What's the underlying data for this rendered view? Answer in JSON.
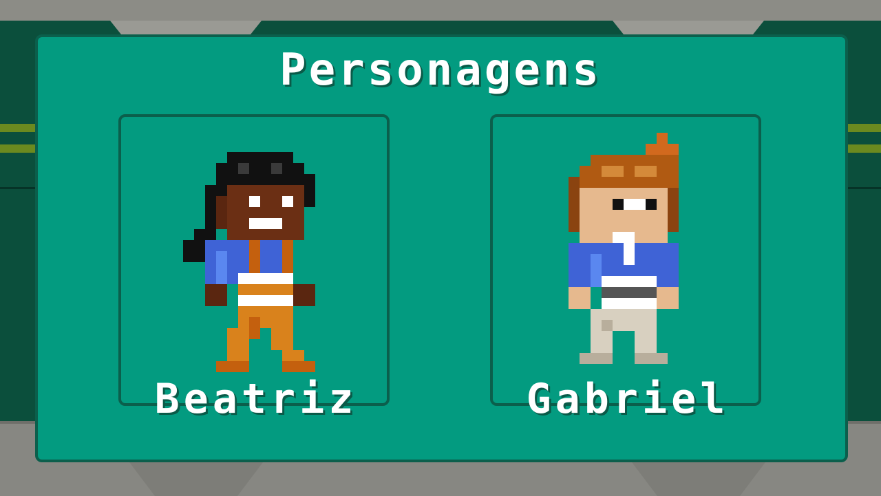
{
  "screen": {
    "title": "Personagens"
  },
  "characters": [
    {
      "name": "Beatriz",
      "sprite": "girl-with-braids",
      "colors": {
        "hair": "#111111",
        "skin": "#6b2f14",
        "shirt": "#3f63d6",
        "pants": "#d9821c"
      }
    },
    {
      "name": "Gabriel",
      "sprite": "boy-with-brown-hair",
      "colors": {
        "hair": "#b05a12",
        "skin": "#e6b98e",
        "shirt": "#3f63d6",
        "pants": "#d8d0c0"
      }
    }
  ],
  "colors": {
    "panel": "#039b80",
    "panel_border": "#0b5f4c",
    "wall": "#0b4f3c",
    "floor": "#878782",
    "text": "#ffffff"
  }
}
